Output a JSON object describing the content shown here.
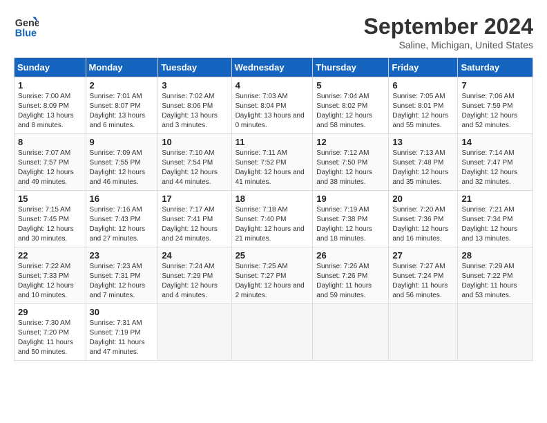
{
  "header": {
    "logo_line1": "General",
    "logo_line2": "Blue",
    "month": "September 2024",
    "location": "Saline, Michigan, United States"
  },
  "days_of_week": [
    "Sunday",
    "Monday",
    "Tuesday",
    "Wednesday",
    "Thursday",
    "Friday",
    "Saturday"
  ],
  "weeks": [
    [
      {
        "day": 1,
        "sunrise": "7:00 AM",
        "sunset": "8:09 PM",
        "daylight": "13 hours and 8 minutes."
      },
      {
        "day": 2,
        "sunrise": "7:01 AM",
        "sunset": "8:07 PM",
        "daylight": "13 hours and 6 minutes."
      },
      {
        "day": 3,
        "sunrise": "7:02 AM",
        "sunset": "8:06 PM",
        "daylight": "13 hours and 3 minutes."
      },
      {
        "day": 4,
        "sunrise": "7:03 AM",
        "sunset": "8:04 PM",
        "daylight": "13 hours and 0 minutes."
      },
      {
        "day": 5,
        "sunrise": "7:04 AM",
        "sunset": "8:02 PM",
        "daylight": "12 hours and 58 minutes."
      },
      {
        "day": 6,
        "sunrise": "7:05 AM",
        "sunset": "8:01 PM",
        "daylight": "12 hours and 55 minutes."
      },
      {
        "day": 7,
        "sunrise": "7:06 AM",
        "sunset": "7:59 PM",
        "daylight": "12 hours and 52 minutes."
      }
    ],
    [
      {
        "day": 8,
        "sunrise": "7:07 AM",
        "sunset": "7:57 PM",
        "daylight": "12 hours and 49 minutes."
      },
      {
        "day": 9,
        "sunrise": "7:09 AM",
        "sunset": "7:55 PM",
        "daylight": "12 hours and 46 minutes."
      },
      {
        "day": 10,
        "sunrise": "7:10 AM",
        "sunset": "7:54 PM",
        "daylight": "12 hours and 44 minutes."
      },
      {
        "day": 11,
        "sunrise": "7:11 AM",
        "sunset": "7:52 PM",
        "daylight": "12 hours and 41 minutes."
      },
      {
        "day": 12,
        "sunrise": "7:12 AM",
        "sunset": "7:50 PM",
        "daylight": "12 hours and 38 minutes."
      },
      {
        "day": 13,
        "sunrise": "7:13 AM",
        "sunset": "7:48 PM",
        "daylight": "12 hours and 35 minutes."
      },
      {
        "day": 14,
        "sunrise": "7:14 AM",
        "sunset": "7:47 PM",
        "daylight": "12 hours and 32 minutes."
      }
    ],
    [
      {
        "day": 15,
        "sunrise": "7:15 AM",
        "sunset": "7:45 PM",
        "daylight": "12 hours and 30 minutes."
      },
      {
        "day": 16,
        "sunrise": "7:16 AM",
        "sunset": "7:43 PM",
        "daylight": "12 hours and 27 minutes."
      },
      {
        "day": 17,
        "sunrise": "7:17 AM",
        "sunset": "7:41 PM",
        "daylight": "12 hours and 24 minutes."
      },
      {
        "day": 18,
        "sunrise": "7:18 AM",
        "sunset": "7:40 PM",
        "daylight": "12 hours and 21 minutes."
      },
      {
        "day": 19,
        "sunrise": "7:19 AM",
        "sunset": "7:38 PM",
        "daylight": "12 hours and 18 minutes."
      },
      {
        "day": 20,
        "sunrise": "7:20 AM",
        "sunset": "7:36 PM",
        "daylight": "12 hours and 16 minutes."
      },
      {
        "day": 21,
        "sunrise": "7:21 AM",
        "sunset": "7:34 PM",
        "daylight": "12 hours and 13 minutes."
      }
    ],
    [
      {
        "day": 22,
        "sunrise": "7:22 AM",
        "sunset": "7:33 PM",
        "daylight": "12 hours and 10 minutes."
      },
      {
        "day": 23,
        "sunrise": "7:23 AM",
        "sunset": "7:31 PM",
        "daylight": "12 hours and 7 minutes."
      },
      {
        "day": 24,
        "sunrise": "7:24 AM",
        "sunset": "7:29 PM",
        "daylight": "12 hours and 4 minutes."
      },
      {
        "day": 25,
        "sunrise": "7:25 AM",
        "sunset": "7:27 PM",
        "daylight": "12 hours and 2 minutes."
      },
      {
        "day": 26,
        "sunrise": "7:26 AM",
        "sunset": "7:26 PM",
        "daylight": "11 hours and 59 minutes."
      },
      {
        "day": 27,
        "sunrise": "7:27 AM",
        "sunset": "7:24 PM",
        "daylight": "11 hours and 56 minutes."
      },
      {
        "day": 28,
        "sunrise": "7:29 AM",
        "sunset": "7:22 PM",
        "daylight": "11 hours and 53 minutes."
      }
    ],
    [
      {
        "day": 29,
        "sunrise": "7:30 AM",
        "sunset": "7:20 PM",
        "daylight": "11 hours and 50 minutes."
      },
      {
        "day": 30,
        "sunrise": "7:31 AM",
        "sunset": "7:19 PM",
        "daylight": "11 hours and 47 minutes."
      },
      null,
      null,
      null,
      null,
      null
    ]
  ]
}
